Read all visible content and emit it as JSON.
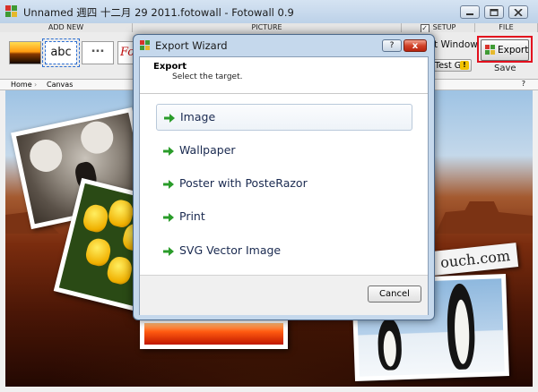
{
  "window": {
    "title": "Unnamed 週四 十二月 29 2011.fotowall - Fotowall 0.9",
    "controls": {
      "minimize": "minimize",
      "maximize": "maximize",
      "close": "close"
    }
  },
  "toolbar": {
    "sections": [
      "ADD NEW",
      "PICTURE",
      "SETUP",
      "FILE"
    ],
    "thumbnails": [
      {
        "name": "sunset-picture",
        "text": ""
      },
      {
        "name": "text-item",
        "text": "abc"
      },
      {
        "name": "web-item",
        "text": ""
      },
      {
        "name": "wordcloud-item",
        "text": "Fo"
      }
    ],
    "setup": {
      "window_label": "t Window",
      "testgl_label": "Test GL",
      "checkbox_checked": true
    },
    "file": {
      "export_label": "Export",
      "save_label": "Save"
    }
  },
  "breadcrumb": {
    "items": [
      "Home",
      "Canvas"
    ],
    "help": "?"
  },
  "canvas": {
    "card_text": "ouch.com"
  },
  "dialog": {
    "title": "Export Wizard",
    "help": "?",
    "close": "x",
    "header_title": "Export",
    "header_subtitle": "Select the target.",
    "options": [
      "Image",
      "Wallpaper",
      "Poster with PosteRazor",
      "Print",
      "SVG Vector Image"
    ],
    "cancel_label": "Cancel"
  },
  "colors": {
    "accent_red": "#e3101e",
    "arrow_green": "#2a9c2a",
    "title_blue": "#c5d8ec"
  }
}
